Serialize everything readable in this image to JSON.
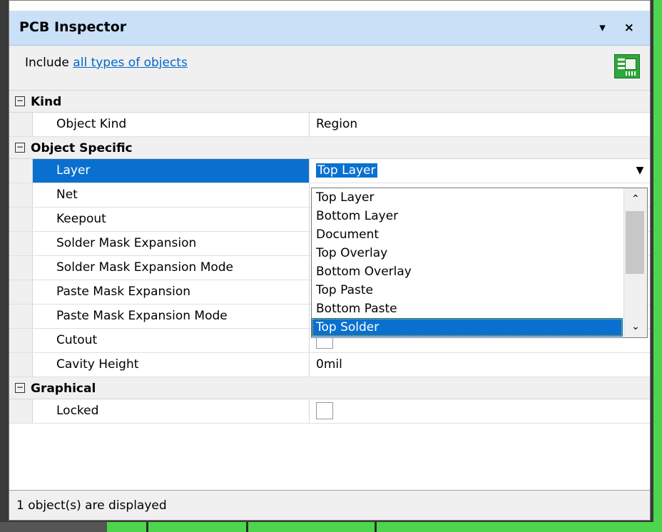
{
  "window": {
    "title": "PCB Inspector",
    "menu_icon": "▾",
    "close_icon": "×"
  },
  "include": {
    "prefix": "Include",
    "link": "all types of objects"
  },
  "sections": {
    "kind": {
      "label": "Kind",
      "rows": [
        {
          "name": "Object Kind",
          "value": "Region"
        }
      ]
    },
    "specific": {
      "label": "Object Specific",
      "rows": [
        {
          "name": "Layer",
          "value": "Top Layer"
        },
        {
          "name": "Net",
          "value": ""
        },
        {
          "name": "Keepout",
          "value": ""
        },
        {
          "name": "Solder Mask Expansion",
          "value": ""
        },
        {
          "name": "Solder Mask Expansion Mode",
          "value": ""
        },
        {
          "name": "Paste Mask Expansion",
          "value": ""
        },
        {
          "name": "Paste Mask Expansion Mode",
          "value": ""
        },
        {
          "name": "Cutout",
          "value": ""
        },
        {
          "name": "Cavity Height",
          "value": "0mil"
        }
      ]
    },
    "graphical": {
      "label": "Graphical",
      "rows": [
        {
          "name": "Locked",
          "value": ""
        }
      ]
    }
  },
  "layer_dropdown": {
    "options": [
      "Top Layer",
      "Bottom Layer",
      "Document",
      "Top Overlay",
      "Bottom Overlay",
      "Top Paste",
      "Bottom Paste",
      "Top Solder"
    ],
    "highlighted": "Top Solder"
  },
  "status": "1 object(s) are displayed",
  "icons": {
    "collapse": "⊟",
    "dropdown_arrow": "▼",
    "scroll_up": "⌃",
    "scroll_down": "⌄"
  },
  "colors": {
    "title_bg": "#c9e0f7",
    "selection": "#0a70d0",
    "link": "#0066cc",
    "pcb_green": "#4dd64d"
  }
}
